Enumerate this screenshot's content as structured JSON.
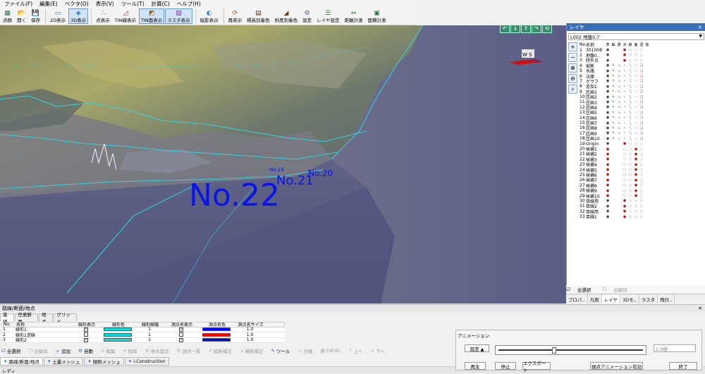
{
  "menu": [
    "ファイル(F)",
    "編集(E)",
    "ベクタ(O)",
    "表示(V)",
    "ツール(T)",
    "計算(C)",
    "ヘルプ(H)"
  ],
  "toolbar": [
    {
      "label": "点群",
      "icon": "pointcloud-icon",
      "active": false
    },
    {
      "label": "開く",
      "icon": "open-icon",
      "active": false
    },
    {
      "label": "保存",
      "icon": "save-icon",
      "active": false
    },
    {
      "label": "2D表示",
      "icon": "2d-view-icon",
      "active": false
    },
    {
      "label": "3D表示",
      "icon": "3d-view-icon",
      "active": true
    },
    {
      "label": "点表示",
      "icon": "point-display-icon",
      "active": false
    },
    {
      "label": "TIN線表示",
      "icon": "tin-line-icon",
      "active": false
    },
    {
      "label": "TIN面表示",
      "icon": "tin-surface-icon",
      "active": true
    },
    {
      "label": "ラスタ表示",
      "icon": "raster-icon",
      "active": true
    },
    {
      "label": "陰影表示",
      "icon": "shade-icon",
      "active": false
    },
    {
      "label": "再表示",
      "icon": "refresh-icon",
      "active": false
    },
    {
      "label": "標高別着色",
      "icon": "elevation-color-icon",
      "active": false
    },
    {
      "label": "斜度別着色",
      "icon": "slope-color-icon",
      "active": false
    },
    {
      "label": "設定",
      "icon": "settings-icon",
      "active": false
    },
    {
      "label": "レイヤ設定",
      "icon": "layer-settings-icon",
      "active": false
    },
    {
      "label": "距離計測",
      "icon": "distance-icon",
      "active": false
    },
    {
      "label": "面積計測",
      "icon": "area-icon",
      "active": false
    }
  ],
  "viewport": {
    "labels": [
      "No.22",
      "No.21",
      "No.20",
      "No.19"
    ],
    "compass": "W S"
  },
  "layer_panel": {
    "title": "レイヤ",
    "selected": "L002 地盤0.7",
    "headers": [
      "No.",
      "名称",
      "表",
      "編",
      "選",
      "点",
      "線",
      "面",
      "透",
      "抜"
    ],
    "rows": [
      {
        "no": "1",
        "name": "301008"
      },
      {
        "no": "2",
        "name": "地盤0.."
      },
      {
        "no": "3",
        "name": "除外点"
      },
      {
        "no": "4",
        "name": "縦断"
      },
      {
        "no": "5",
        "name": "水路"
      },
      {
        "no": "6",
        "name": "法面"
      },
      {
        "no": "7",
        "name": "グラフ"
      },
      {
        "no": "8",
        "name": "追加1"
      },
      {
        "no": "9",
        "name": "区画1"
      },
      {
        "no": "10",
        "name": "区画2"
      },
      {
        "no": "11",
        "name": "区画3"
      },
      {
        "no": "12",
        "name": "区画4"
      },
      {
        "no": "13",
        "name": "区画5"
      },
      {
        "no": "14",
        "name": "区画6"
      },
      {
        "no": "15",
        "name": "区画7"
      },
      {
        "no": "16",
        "name": "区画8"
      },
      {
        "no": "17",
        "name": "区画9"
      },
      {
        "no": "18",
        "name": "区画10"
      },
      {
        "no": "19",
        "name": "Origin"
      },
      {
        "no": "20",
        "name": "候補1"
      },
      {
        "no": "21",
        "name": "候補2"
      },
      {
        "no": "22",
        "name": "候補3"
      },
      {
        "no": "23",
        "name": "候補4"
      },
      {
        "no": "24",
        "name": "候補5"
      },
      {
        "no": "25",
        "name": "候補6"
      },
      {
        "no": "26",
        "name": "候補7"
      },
      {
        "no": "27",
        "name": "候補8"
      },
      {
        "no": "28",
        "name": "候補9"
      },
      {
        "no": "29",
        "name": "候補10"
      },
      {
        "no": "30",
        "name": "目線用"
      },
      {
        "no": "31",
        "name": "目線2"
      },
      {
        "no": "32",
        "name": "目線用"
      },
      {
        "no": "33",
        "name": "目線1"
      }
    ],
    "select_all": "全選択",
    "deselect_all": "全解除",
    "tabs": [
      "プロパ..",
      "凡例",
      "レイヤ",
      "3Dモ..",
      "ラスタ",
      "飛行.."
    ]
  },
  "bottom_panel": {
    "title": "路線/断面/地点",
    "tabs": [
      "基線",
      "任意断面",
      "地点",
      "グリッド"
    ],
    "headers": [
      "No.",
      "名称",
      "線形表示",
      "線形色",
      "線形線幅",
      "測点名表示",
      "測点名色",
      "測点名サイズ"
    ],
    "rows": [
      {
        "no": "1",
        "name": "線形1",
        "show": true,
        "color": "#00e0e0",
        "width": "1",
        "label_show": true,
        "label_color": "#0000ff",
        "size": "1.0"
      },
      {
        "no": "2",
        "name": "線形1逆線",
        "show": false,
        "color": "#00e0e0",
        "width": "1",
        "label_show": false,
        "label_color": "#ff0000",
        "size": "1.0"
      },
      {
        "no": "3",
        "name": "線形2",
        "show": true,
        "color": "#00e0e0",
        "width": "1",
        "label_show": true,
        "label_color": "#0000ff",
        "size": "1.0"
      }
    ],
    "actions": [
      {
        "label": "全選択",
        "enabled": true
      },
      {
        "label": "全解除",
        "enabled": false
      },
      {
        "label": "追加",
        "enabled": true
      },
      {
        "label": "自動",
        "enabled": true
      },
      {
        "label": "編集",
        "enabled": false
      },
      {
        "label": "削除",
        "enabled": false
      },
      {
        "label": "条件設定",
        "enabled": false
      },
      {
        "label": "測点一覧",
        "enabled": false
      },
      {
        "label": "縦断補正",
        "enabled": false
      },
      {
        "label": "横断補正",
        "enabled": false
      },
      {
        "label": "ツール",
        "enabled": true
      },
      {
        "label": "計画",
        "enabled": false
      },
      {
        "label": "EXCEL",
        "enabled": false
      },
      {
        "label": "上へ",
        "enabled": false
      },
      {
        "label": "下へ",
        "enabled": false
      }
    ],
    "bottom_tabs": [
      "路線/断面/地点",
      "土量メッシュ",
      "傾斜メッシュ",
      "i-Construction"
    ]
  },
  "animation": {
    "title": "アニメーション",
    "settings": "設定 ▲",
    "speed": "1.0倍",
    "progress": 0.38,
    "play": "再生",
    "stop": "停止",
    "export": "エクスポート",
    "viewpoint": "視点アニメーション有効",
    "close": "終了"
  },
  "status": "レディ"
}
